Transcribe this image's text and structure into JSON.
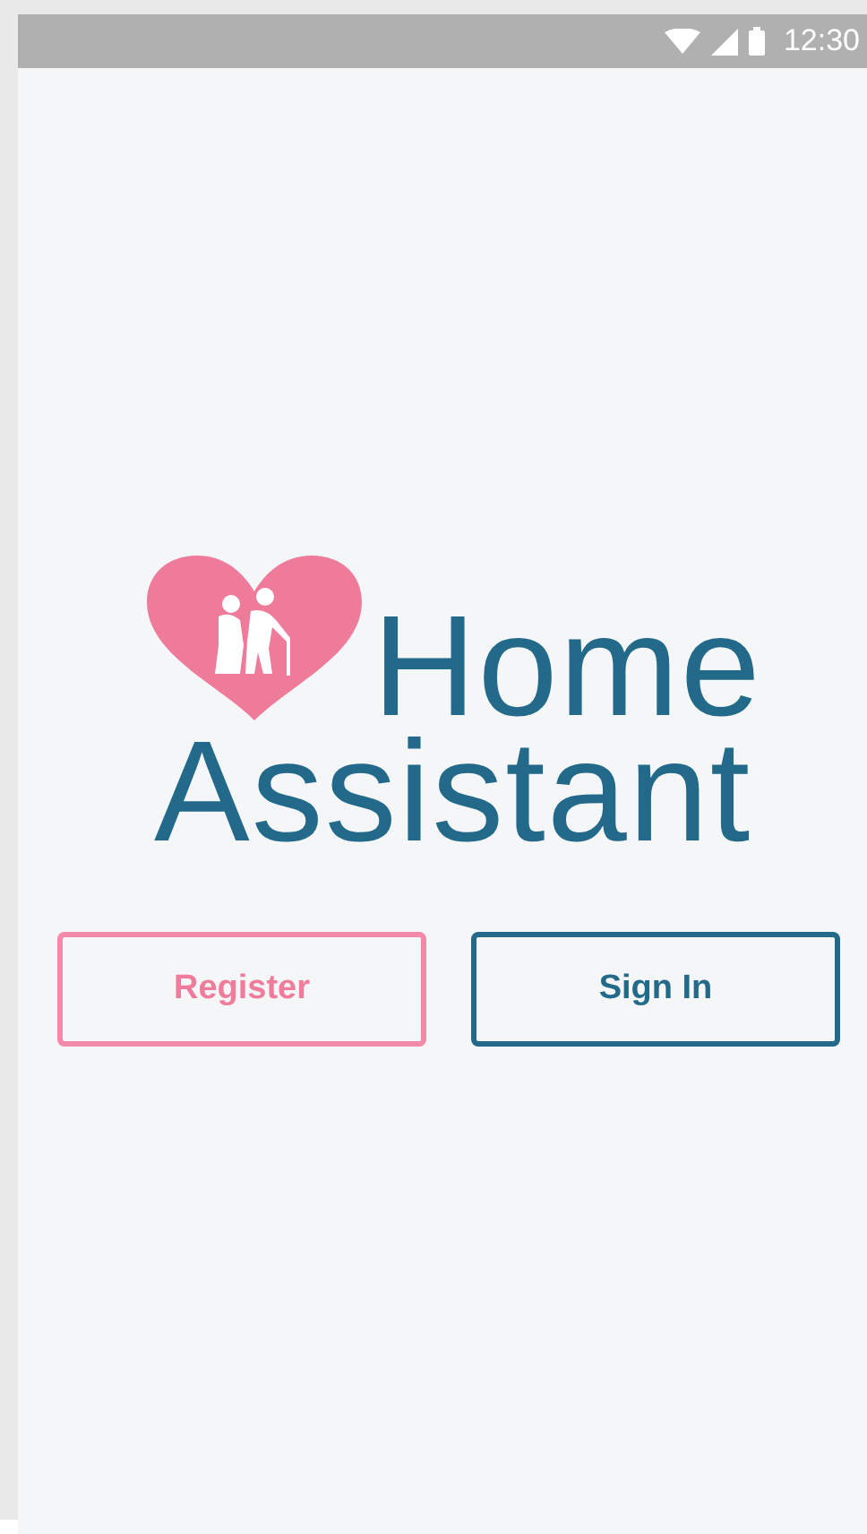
{
  "status_bar": {
    "time": "12:30"
  },
  "logo": {
    "line_1": "Home",
    "line_2": "Assistant"
  },
  "buttons": [
    {
      "label": "Register",
      "kind": "secondary"
    },
    {
      "label": "Sign In",
      "kind": "primary"
    }
  ]
}
